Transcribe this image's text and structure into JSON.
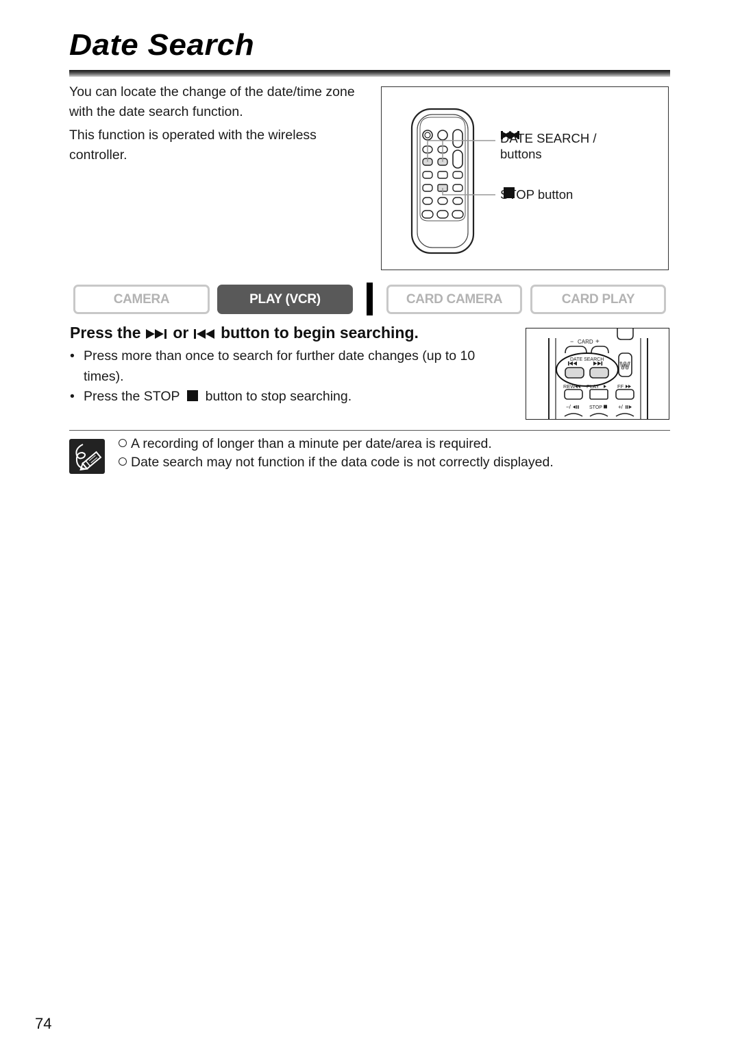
{
  "page": {
    "title": "Date Search",
    "number": "74"
  },
  "intro": {
    "paragraphs": [
      "You can locate the change of the date/time zone with the date search function.",
      "This function is operated with the wireless controller."
    ]
  },
  "remote_figure": {
    "callouts": {
      "date_search_label": "DATE SEARCH",
      "date_search_separator": "/",
      "date_search_suffix": "buttons",
      "stop_label": "STOP",
      "stop_suffix": "button"
    },
    "icons": [
      "skip-forward-icon",
      "skip-back-icon",
      "stop-icon"
    ],
    "highlight_color": "#d9d9d9"
  },
  "mode_tabs": [
    {
      "label": "CAMERA",
      "active": false
    },
    {
      "label": "PLAY (VCR)",
      "active": true
    },
    {
      "label": "CARD CAMERA",
      "active": false
    },
    {
      "label": "CARD PLAY",
      "active": false
    }
  ],
  "step": {
    "heading_prefix": "Press the",
    "heading_or": "or",
    "heading_suffix": "button to begin searching.",
    "bullets": [
      "Press more than once to search for further date changes (up to 10 times).",
      {
        "prefix": "Press the STOP",
        "suffix": "button to stop searching."
      }
    ]
  },
  "closeup_figure": {
    "labels": {
      "card": "CARD",
      "card_minus": "−",
      "card_plus": "+",
      "date_search": "DATE SEARCH",
      "w": "W",
      "rew": "REW",
      "play": "PLAY",
      "ff": "FF",
      "slow_back": "−/",
      "stop": "STOP",
      "slow_fwd": "+/"
    }
  },
  "notes": {
    "icon": "note-pencil-icon",
    "items": [
      "A recording of longer than a minute per date/area is required.",
      "Date search may not function if the data code is not correctly displayed."
    ]
  },
  "colors": {
    "tab_active_bg": "#595959",
    "tab_inactive_text": "#b3b3b3",
    "tab_inactive_border": "#c8c8c8"
  }
}
